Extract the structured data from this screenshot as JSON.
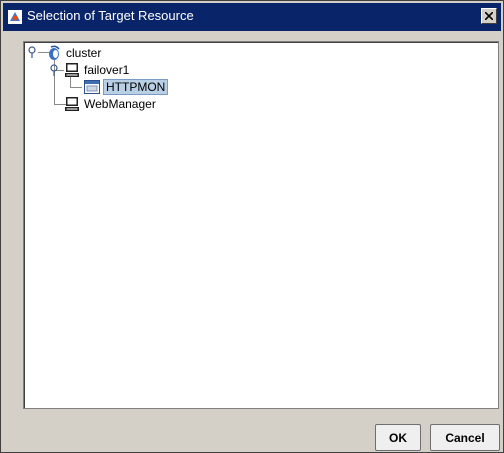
{
  "window": {
    "title": "Selection of Target Resource"
  },
  "tree": {
    "root": {
      "label": "cluster",
      "icon": "cluster-icon"
    },
    "group": {
      "label": "failover1",
      "icon": "computer-icon"
    },
    "resource": {
      "label": "HTTPMON",
      "icon": "monitor-resource-icon",
      "selected": true
    },
    "manager": {
      "label": "WebManager",
      "icon": "computer-icon"
    }
  },
  "buttons": {
    "ok": "OK",
    "cancel": "Cancel"
  },
  "colors": {
    "titlebar": "#0a246a",
    "selection": "#b8cfe5",
    "panel": "#d4d0c8"
  }
}
